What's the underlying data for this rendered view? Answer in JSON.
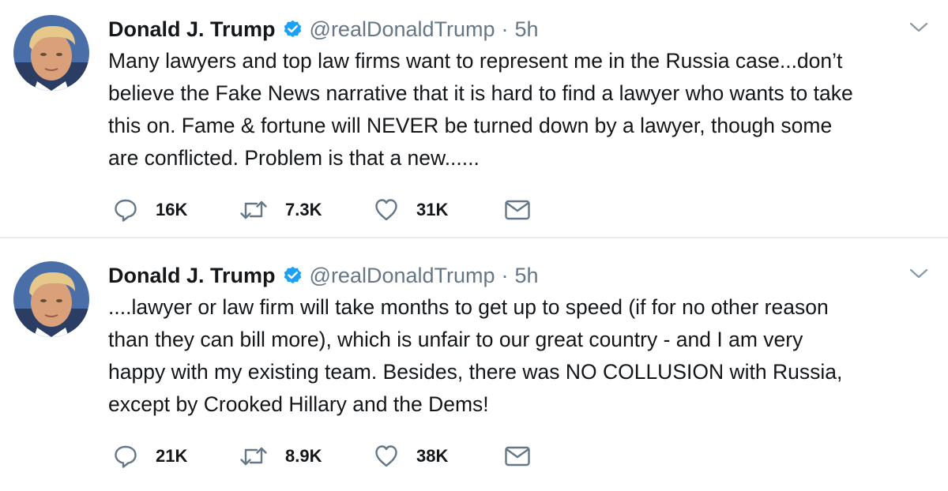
{
  "tweets": [
    {
      "author_name": "Donald J. Trump",
      "handle": "@realDonaldTrump",
      "separator": "·",
      "time": "5h",
      "text": "Many lawyers and top law firms want to represent me in the Russia case...don’t\nbelieve the Fake News narrative that it is hard to find a lawyer who wants to take\nthis on. Fame & fortune will NEVER be turned down by a lawyer, though some\nare conflicted. Problem is that a new......",
      "replies": "16K",
      "retweets": "7.3K",
      "likes": "31K"
    },
    {
      "author_name": "Donald J. Trump",
      "handle": "@realDonaldTrump",
      "separator": "·",
      "time": "5h",
      "text": "....lawyer or law firm will take months to get up to speed (if for no other reason\nthan they can bill more), which is unfair to our great country - and I am very\nhappy with my existing team. Besides, there was NO COLLUSION with Russia,\nexcept by Crooked Hillary and the Dems!",
      "replies": "21K",
      "retweets": "8.9K",
      "likes": "38K"
    }
  ],
  "icons": {
    "verified": "verified-badge-icon",
    "caret": "chevron-down-icon",
    "reply": "reply-icon",
    "retweet": "retweet-icon",
    "like": "heart-icon",
    "message": "envelope-icon"
  },
  "colors": {
    "text": "#14171a",
    "secondary": "#657786",
    "verified_blue": "#1da1f2",
    "divider": "#e6ecf0"
  }
}
